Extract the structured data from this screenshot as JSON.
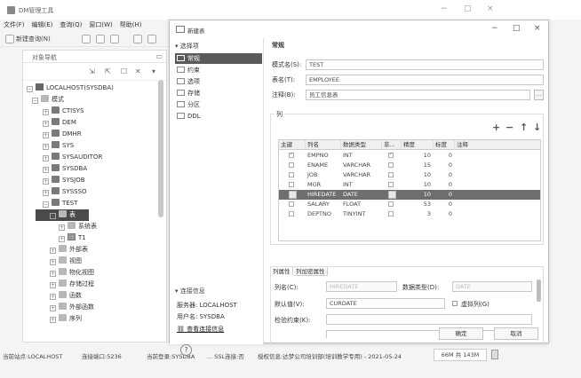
{
  "app": {
    "title": "DM管理工具",
    "menu": [
      "文件(F)",
      "编辑(E)",
      "查询(Q)",
      "窗口(W)",
      "帮助(H)"
    ],
    "toolbar": {
      "new_query": "新建查询(N)"
    },
    "nav_panel": {
      "title": "对象导航"
    },
    "window_controls": {
      "minimize": "−",
      "maximize": "□",
      "close": "×"
    }
  },
  "tree": [
    {
      "label": "LOCALHOST(SYSDBA)",
      "level": 0,
      "expander": "−",
      "icon": "db-icon"
    },
    {
      "label": "模式",
      "level": 1,
      "expander": "−",
      "icon": "folder-icon"
    },
    {
      "label": "CTISYS",
      "level": 2,
      "expander": "+",
      "icon": "schema-icon"
    },
    {
      "label": "DEM",
      "level": 2,
      "expander": "+",
      "icon": "schema-icon"
    },
    {
      "label": "DMHR",
      "level": 2,
      "expander": "+",
      "icon": "schema-icon"
    },
    {
      "label": "SYS",
      "level": 2,
      "expander": "+",
      "icon": "schema-icon"
    },
    {
      "label": "SYSAUDITOR",
      "level": 2,
      "expander": "+",
      "icon": "schema-icon"
    },
    {
      "label": "SYSDBA",
      "level": 2,
      "expander": "+",
      "icon": "schema-icon"
    },
    {
      "label": "SYSJOB",
      "level": 2,
      "expander": "+",
      "icon": "schema-icon"
    },
    {
      "label": "SYSSSO",
      "level": 2,
      "expander": "+",
      "icon": "schema-icon"
    },
    {
      "label": "TEST",
      "level": 2,
      "expander": "−",
      "icon": "schema-icon"
    },
    {
      "label": "表",
      "level": 3,
      "expander": "−",
      "icon": "folder-icon",
      "selected": true
    },
    {
      "label": "系统表",
      "level": 4,
      "expander": "+",
      "icon": "folder-icon"
    },
    {
      "label": "T1",
      "level": 4,
      "expander": "+",
      "icon": "table-icon"
    },
    {
      "label": "外部表",
      "level": 3,
      "expander": "+",
      "icon": "folder-icon"
    },
    {
      "label": "视图",
      "level": 3,
      "expander": "+",
      "icon": "folder-icon"
    },
    {
      "label": "物化视图",
      "level": 3,
      "expander": "+",
      "icon": "folder-icon"
    },
    {
      "label": "存储过程",
      "level": 3,
      "expander": "+",
      "icon": "folder-icon"
    },
    {
      "label": "函数",
      "level": 3,
      "expander": "+",
      "icon": "folder-icon"
    },
    {
      "label": "外部函数",
      "level": 3,
      "expander": "+",
      "icon": "folder-icon"
    },
    {
      "label": "序列",
      "level": 3,
      "expander": "+",
      "icon": "folder-icon"
    }
  ],
  "status": {
    "site": "当前站点:LOCALHOST",
    "port": "连接端口:5236",
    "login": "当前登录:SYSDBA",
    "ssl": "... SSL连接:否",
    "license": "授权信息:达梦公司培训部(培训教学专用) - 2021-05-24",
    "memory": "66M 共 143M"
  },
  "dialog": {
    "title": "新建表",
    "sidebar": {
      "heading": "选择项",
      "items": [
        "常规",
        "约束",
        "选项",
        "存储",
        "分区",
        "DDL"
      ],
      "conn_heading": "连接信息",
      "server": "服务器: LOCALHOST",
      "user": "用户名: SYSDBA",
      "view_conn": "查看连接信息"
    },
    "general": {
      "section": "常规",
      "schema_label": "模式名(S):",
      "schema_value": "TEST",
      "table_label": "表名(T):",
      "table_value": "EMPLOYEE",
      "comment_label": "注释(B):",
      "comment_value": "员工信息表",
      "more": "..."
    },
    "columns": {
      "caption": "列",
      "tools": [
        "+",
        "−",
        "↑",
        "↓"
      ],
      "headers": [
        "主键",
        "列名",
        "数据类型",
        "非...",
        "精度",
        "标度",
        "注释"
      ],
      "rows": [
        {
          "pk": true,
          "name": "EMPNO",
          "type": "INT",
          "notnull": true,
          "precision": "10",
          "scale": "0",
          "comment": ""
        },
        {
          "pk": false,
          "name": "ENAME",
          "type": "VARCHAR",
          "notnull": false,
          "precision": "15",
          "scale": "0",
          "comment": ""
        },
        {
          "pk": false,
          "name": "JOB",
          "type": "VARCHAR",
          "notnull": false,
          "precision": "10",
          "scale": "0",
          "comment": ""
        },
        {
          "pk": false,
          "name": "MGR",
          "type": "INT",
          "notnull": false,
          "precision": "10",
          "scale": "0",
          "comment": ""
        },
        {
          "pk": false,
          "name": "HIREDATE",
          "type": "DATE",
          "notnull": false,
          "precision": "10",
          "scale": "0",
          "comment": "",
          "selected": true
        },
        {
          "pk": false,
          "name": "SALARY",
          "type": "FLOAT",
          "notnull": false,
          "precision": "53",
          "scale": "0",
          "comment": ""
        },
        {
          "pk": false,
          "name": "DEPTNO",
          "type": "TINYINT",
          "notnull": false,
          "precision": "3",
          "scale": "0",
          "comment": ""
        }
      ]
    },
    "col_props": {
      "tabs": [
        "列属性",
        "列加密属性"
      ],
      "colname_label": "列名(C):",
      "colname_value": "HIREDATE",
      "dtype_label": "数据类型(D):",
      "dtype_value": "DATE",
      "default_label": "默认值(V):",
      "default_value": "CURDATE",
      "virtual_label": "虚拟列(G)",
      "check_label": "检验约束(K):"
    },
    "buttons": {
      "ok": "确定",
      "cancel": "取消"
    }
  }
}
